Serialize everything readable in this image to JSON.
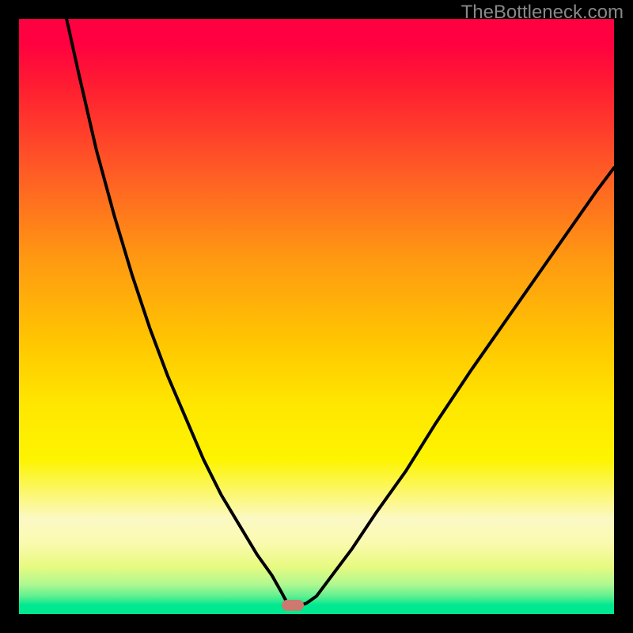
{
  "attribution": "TheBottleneck.com",
  "chart_data": {
    "type": "line",
    "title": "",
    "xlabel": "",
    "ylabel": "",
    "xlim": [
      0,
      100
    ],
    "ylim": [
      0,
      100
    ],
    "trough_xy": [
      46.0,
      98.6
    ],
    "series": [
      {
        "name": "bottleneck-curve",
        "x": [
          8.0,
          10,
          13,
          16,
          19,
          22,
          25,
          28,
          31,
          34,
          37,
          40,
          42.5,
          44.2,
          45.0,
          46.0,
          47.0,
          48.3,
          50.0,
          53,
          56,
          60,
          65,
          70,
          76,
          83,
          90,
          97,
          100
        ],
        "y": [
          0.0,
          9,
          22,
          33,
          43,
          52,
          60,
          67,
          74,
          80,
          85,
          90,
          93.5,
          96.5,
          98.0,
          98.6,
          98.6,
          98.2,
          97.0,
          93,
          89,
          83,
          76,
          68,
          59,
          49,
          39,
          29,
          25
        ]
      }
    ],
    "gradient_stops": [
      {
        "pos": 0.0,
        "color": "#ff0040"
      },
      {
        "pos": 0.12,
        "color": "#ff2030"
      },
      {
        "pos": 0.26,
        "color": "#ff5d25"
      },
      {
        "pos": 0.4,
        "color": "#ff9812"
      },
      {
        "pos": 0.55,
        "color": "#ffc800"
      },
      {
        "pos": 0.65,
        "color": "#ffe700"
      },
      {
        "pos": 0.74,
        "color": "#fdf400"
      },
      {
        "pos": 0.84,
        "color": "#fbf9c4"
      },
      {
        "pos": 0.92,
        "color": "#e8fa80"
      },
      {
        "pos": 0.97,
        "color": "#60f090"
      },
      {
        "pos": 1.0,
        "color": "#00e890"
      }
    ]
  }
}
